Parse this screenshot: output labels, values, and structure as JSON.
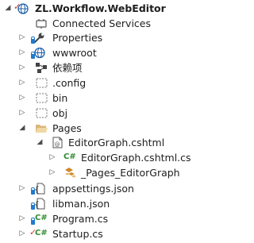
{
  "tree": {
    "items": [
      {
        "label": "ZL.Workflow.WebEditor",
        "icon": "web-project-icon",
        "expander": "expanded",
        "bold": true
      },
      {
        "label": "Connected Services",
        "icon": "connected-services-icon",
        "expander": "none"
      },
      {
        "label": "Properties",
        "icon": "wrench-properties-icon",
        "expander": "collapsed"
      },
      {
        "label": "wwwroot",
        "icon": "globe-icon",
        "expander": "collapsed"
      },
      {
        "label": "依赖项",
        "icon": "dependencies-icon",
        "expander": "collapsed"
      },
      {
        "label": ".config",
        "icon": "folder-dashed-icon",
        "expander": "collapsed"
      },
      {
        "label": "bin",
        "icon": "folder-dashed-icon",
        "expander": "collapsed"
      },
      {
        "label": "obj",
        "icon": "folder-dashed-icon",
        "expander": "collapsed"
      },
      {
        "label": "Pages",
        "icon": "folder-open-icon",
        "expander": "expanded"
      },
      {
        "label": "EditorGraph.cshtml",
        "icon": "cshtml-file-icon",
        "expander": "expanded"
      },
      {
        "label": "EditorGraph.cshtml.cs",
        "icon": "csharp-file-icon",
        "expander": "collapsed"
      },
      {
        "label": "_Pages_EditorGraph",
        "icon": "class-icon",
        "expander": "collapsed"
      },
      {
        "label": "appsettings.json",
        "icon": "json-file-icon",
        "expander": "collapsed"
      },
      {
        "label": "libman.json",
        "icon": "json-file-icon",
        "expander": "none"
      },
      {
        "label": "Program.cs",
        "icon": "csharp-file-icon",
        "expander": "collapsed"
      },
      {
        "label": "Startup.cs",
        "icon": "csharp-file-icon",
        "expander": "collapsed"
      }
    ]
  },
  "colors": {
    "text": "#1e1e1e",
    "folder": "#dcb67a",
    "csharp": "#2f8a2f",
    "lock": "#1f7bd0",
    "pending_check": "#d23a2e"
  }
}
